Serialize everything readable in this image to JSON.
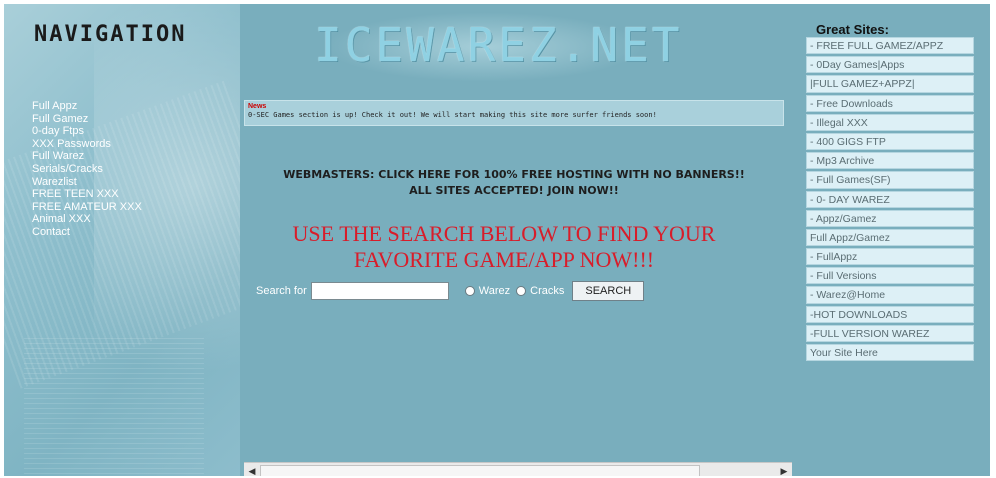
{
  "nav": {
    "title": "NAVIGATION",
    "links": [
      "Full Appz",
      "Full Gamez",
      "0-day Ftps",
      "XXX Passwords",
      "Full Warez",
      "Serials/Cracks",
      "Warezlist",
      "FREE TEEN XXX",
      "FREE AMATEUR XXX",
      "Animal XXX",
      "Contact"
    ]
  },
  "header": {
    "logo": "ICEWAREZ.NET"
  },
  "news": {
    "label": "News",
    "text": "0-SEC Games section is up! Check it out! We will start making this site more surfer friends soon!"
  },
  "webmasters": {
    "line1": "WEBMASTERS: CLICK HERE FOR 100% FREE HOSTING WITH NO BANNERS!!",
    "line2": "ALL SITES ACCEPTED! JOIN NOW!!"
  },
  "headline": {
    "line1": "USE THE SEARCH BELOW TO FIND YOUR",
    "line2": "FAVORITE GAME/APP NOW!!!"
  },
  "search": {
    "label": "Search for",
    "value": "",
    "option_warez": "Warez",
    "option_cracks": "Cracks",
    "button": "SEARCH"
  },
  "sites": {
    "title": "Great Sites:",
    "items": [
      "- FREE FULL GAMEZ/APPZ",
      "- 0Day Games|Apps",
      "|FULL GAMEZ+APPZ|",
      "- Free Downloads",
      "- Illegal XXX",
      "- 400 GIGS FTP",
      "- Mp3 Archive",
      "- Full Games(SF)",
      "- 0- DAY WAREZ",
      "- Appz/Gamez",
      "Full Appz/Gamez",
      "- FullAppz",
      "- Full Versions",
      "- Warez@Home",
      "-HOT DOWNLOADS",
      "-FULL VERSION WAREZ",
      "Your Site Here"
    ]
  },
  "colors": {
    "background": "#79aebd",
    "headline": "#d81d2a",
    "site_link_bg": "#ddf0f6"
  }
}
